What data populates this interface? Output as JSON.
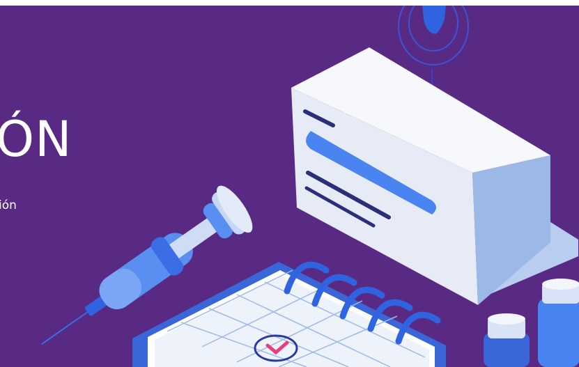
{
  "hero": {
    "title": "ÓN",
    "subtitle": "ión"
  },
  "colors": {
    "background": "#592a84",
    "accent_blue": "#4a84f0",
    "box_face": "#eef1f8",
    "box_side": "#9cb8e6",
    "ink": "#2a2f7a",
    "check_pink": "#e4407a"
  }
}
